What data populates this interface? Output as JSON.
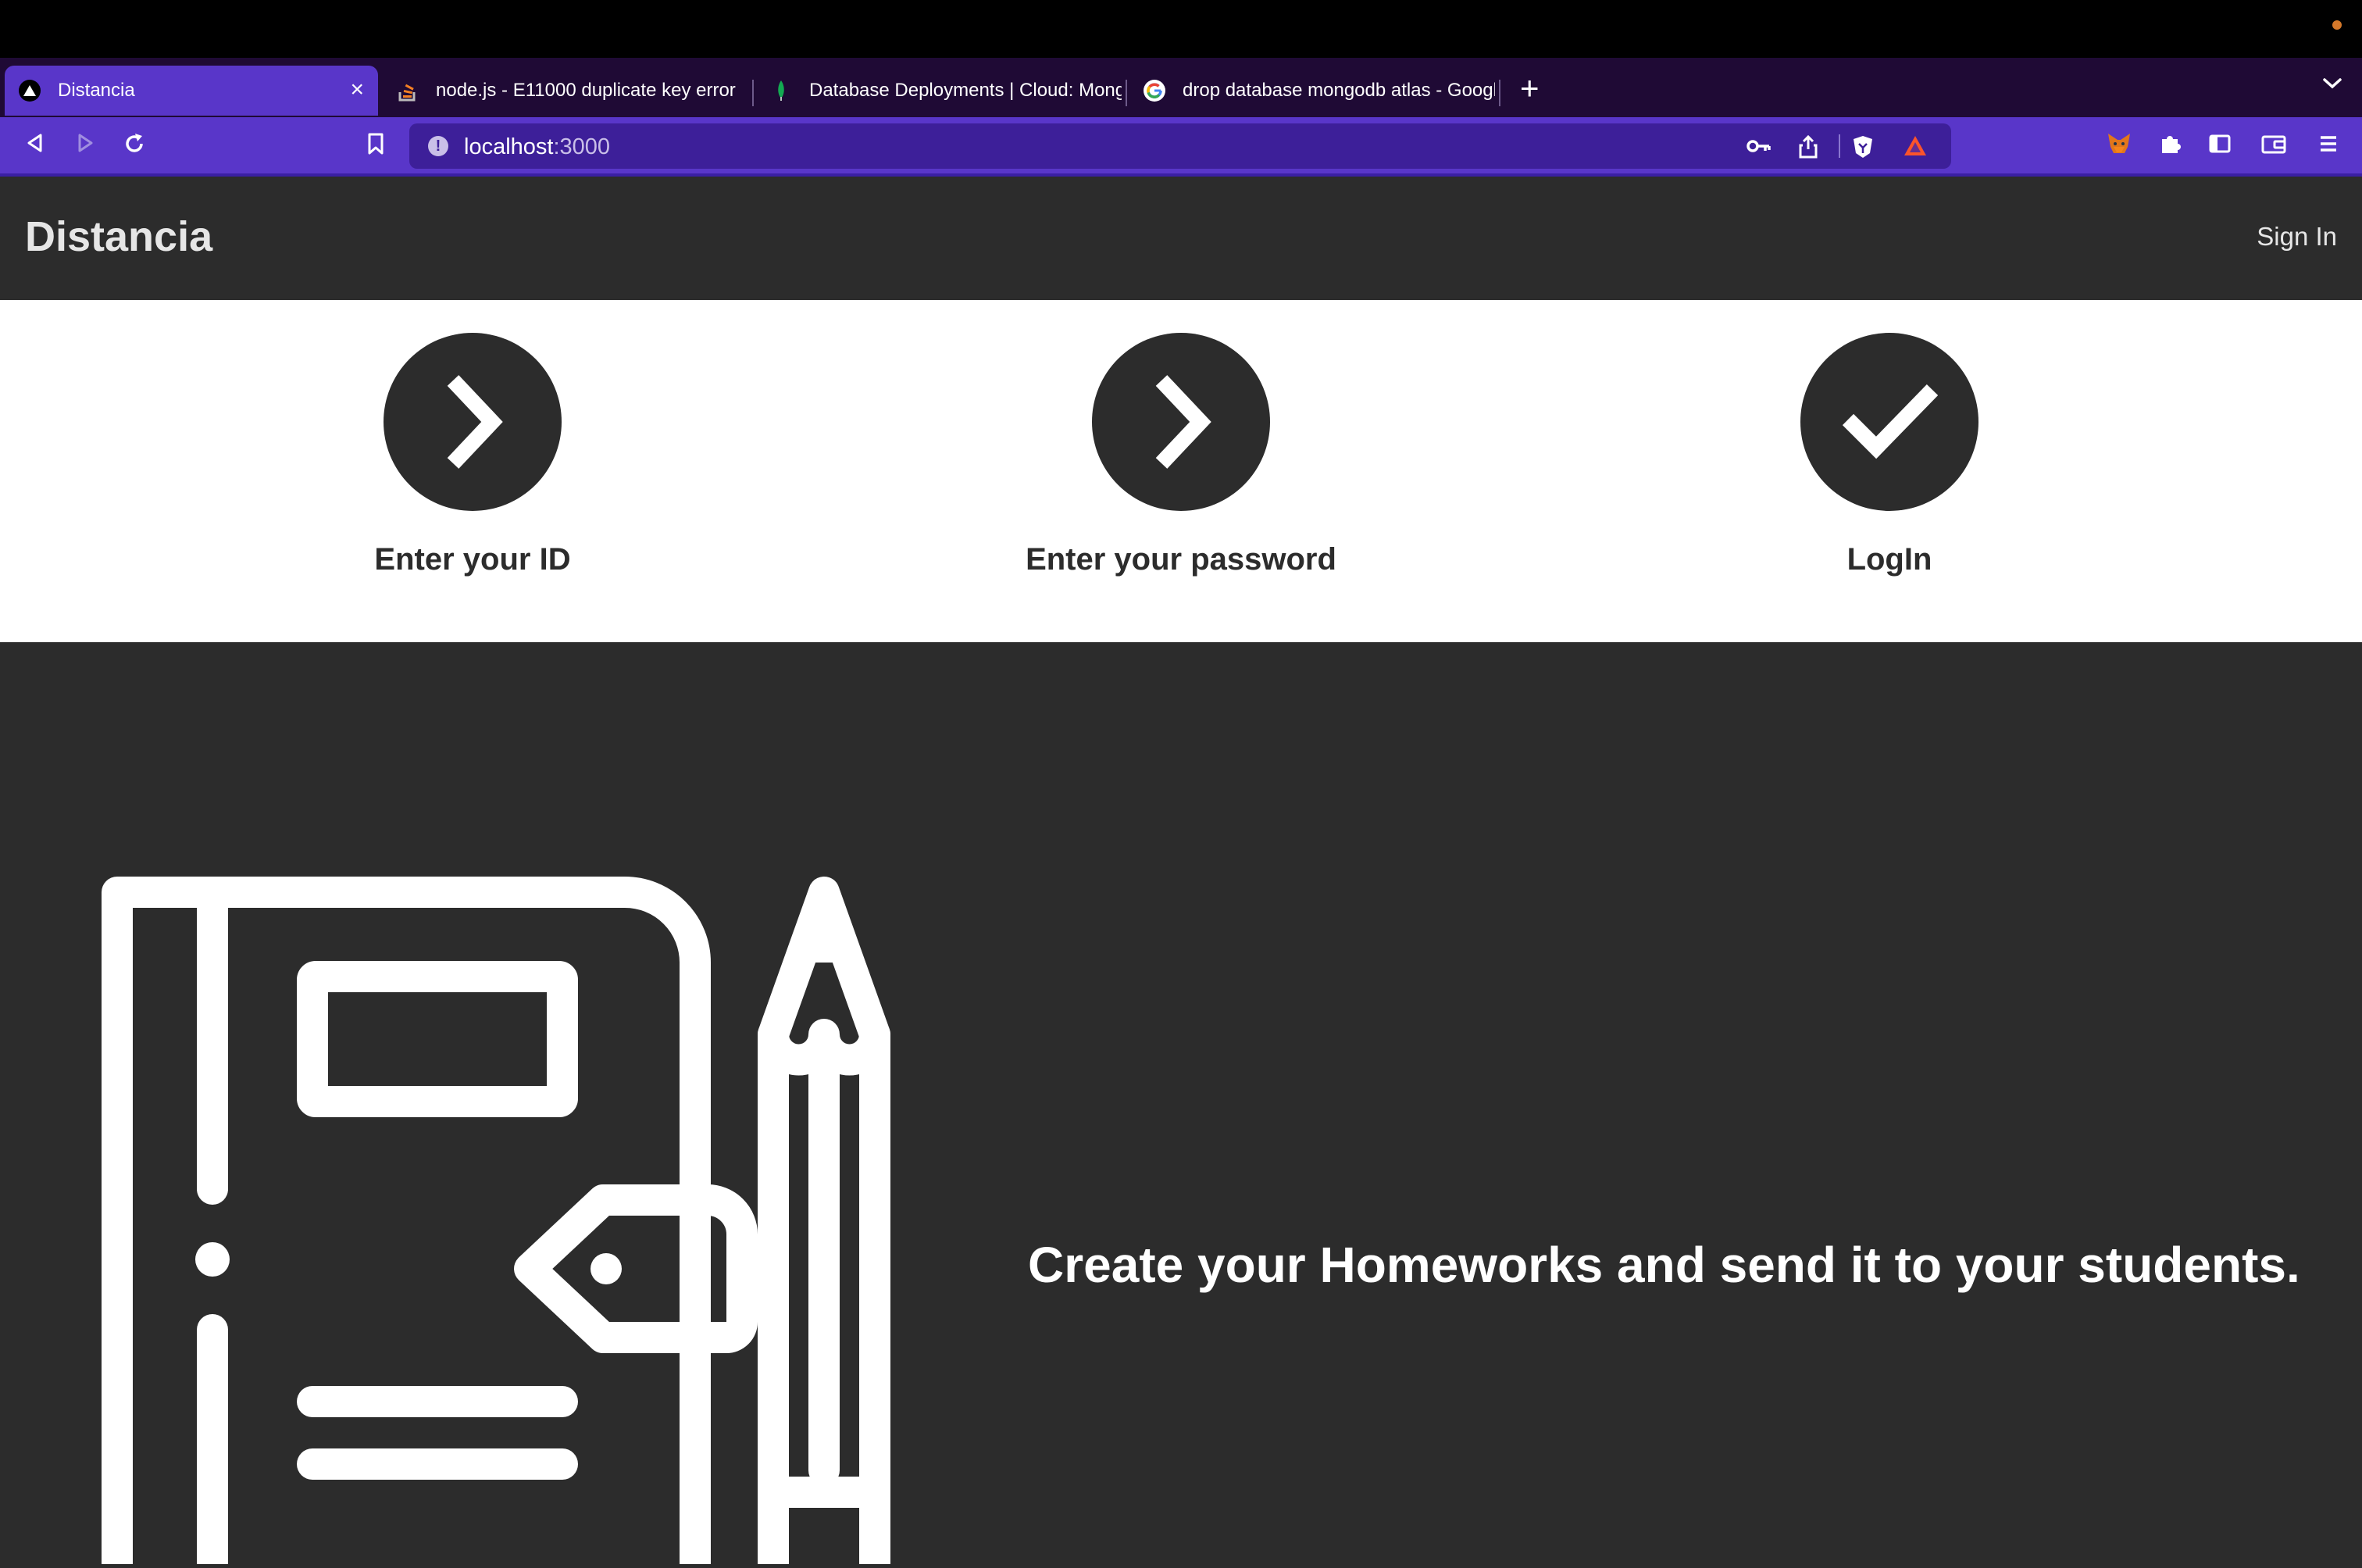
{
  "browser": {
    "tabs": [
      {
        "title": "Distancia",
        "active": true
      },
      {
        "title": "node.js - E11000 duplicate key error",
        "active": false
      },
      {
        "title": "Database Deployments | Cloud: MongoDB",
        "active": false
      },
      {
        "title": "drop database mongodb atlas - Google",
        "active": false
      }
    ],
    "url_host": "localhost",
    "url_port": ":3000",
    "colors": {
      "chrome_accent": "#5936c9",
      "tab_strip": "#1f0a35"
    }
  },
  "header": {
    "brand": "Distancia",
    "signin": "Sign In"
  },
  "steps": [
    {
      "label": "Enter your ID",
      "icon": "chevron-right-icon"
    },
    {
      "label": "Enter your password",
      "icon": "chevron-right-icon"
    },
    {
      "label": "LogIn",
      "icon": "check-icon"
    }
  ],
  "feature": {
    "text": "Create your Homeworks and send it to your students.",
    "illustration": "notebook-pencil-icon"
  }
}
